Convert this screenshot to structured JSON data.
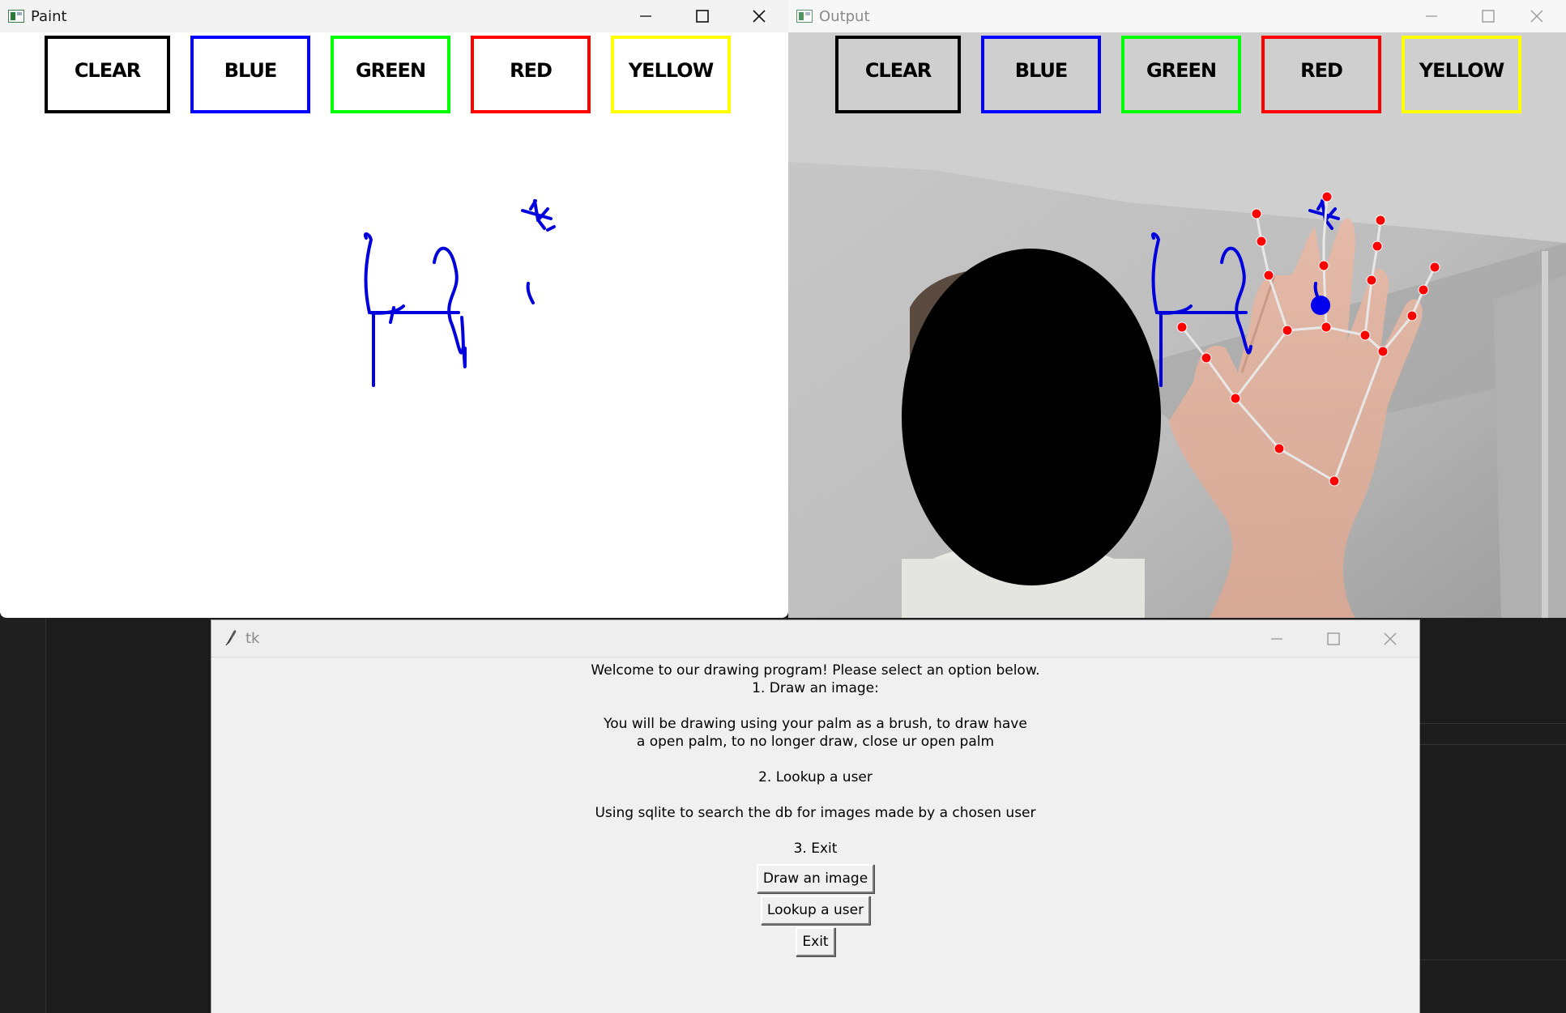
{
  "paint_window": {
    "title": "Paint",
    "color_buttons": [
      {
        "label": "CLEAR",
        "color": "#000000"
      },
      {
        "label": "BLUE",
        "color": "#0000ff"
      },
      {
        "label": "GREEN",
        "color": "#00ff00"
      },
      {
        "label": "RED",
        "color": "#ff0000"
      },
      {
        "label": "YELLOW",
        "color": "#ffff00"
      }
    ],
    "stroke_color": "#0000dd"
  },
  "output_window": {
    "title": "Output",
    "color_buttons": [
      {
        "label": "CLEAR",
        "color": "#000000"
      },
      {
        "label": "BLUE",
        "color": "#0000ff"
      },
      {
        "label": "GREEN",
        "color": "#00ff00"
      },
      {
        "label": "RED",
        "color": "#ff0000"
      },
      {
        "label": "YELLOW",
        "color": "#ffff00"
      }
    ],
    "landmark_color": "#ff0000"
  },
  "tk_window": {
    "title": "tk",
    "lines": [
      "Welcome to our drawing program! Please select an option below.",
      "1. Draw an image:",
      "",
      "You will be drawing using your palm as a brush, to draw have",
      "a open palm, to no longer draw, close ur open palm",
      "",
      "2. Lookup a user",
      "",
      "Using sqlite to search the db for images made by a chosen user",
      "",
      "3. Exit"
    ],
    "buttons": {
      "draw": "Draw an image",
      "lookup": "Lookup a user",
      "exit": "Exit"
    }
  }
}
